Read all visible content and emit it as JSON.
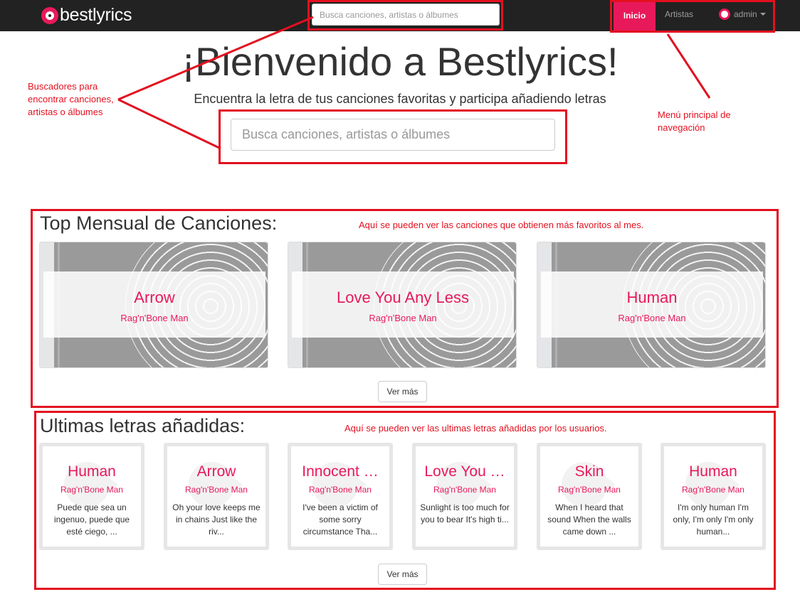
{
  "navbar": {
    "brand": "bestlyrics",
    "search_placeholder": "Busca canciones, artistas o álbumes",
    "nav_items": [
      "Inicio",
      "Artistas"
    ],
    "user_label": "admin"
  },
  "hero": {
    "title": "¡Bienvenido a Bestlyrics!",
    "subtitle": "Encuentra la letra de tus canciones favoritas y participa añadiendo letras",
    "search_placeholder": "Busca canciones, artistas o álbumes"
  },
  "annotations": {
    "search_note": "Buscadores para encontrar canciones, artistas o álbumes",
    "menu_note": "Menú principal de navegación",
    "top_note": "Aquí se pueden ver las canciones que obtienen más favoritos al mes.",
    "latest_note": "Aquí se pueden ver las ultimas letras añadidas por los usuarios.",
    "color": "#e3101f"
  },
  "top_monthly": {
    "title": "Top Mensual de Canciones:",
    "songs": [
      {
        "title": "Arrow",
        "artist": "Rag'n'Bone Man"
      },
      {
        "title": "Love You Any Less",
        "artist": "Rag'n'Bone Man"
      },
      {
        "title": "Human",
        "artist": "Rag'n'Bone Man"
      }
    ],
    "more_label": "Ver más"
  },
  "latest": {
    "title": "Ultimas letras añadidas:",
    "songs": [
      {
        "title": "Human",
        "artist": "Rag'n'Bone Man",
        "snippet": "Puede que sea un ingenuo, puede que esté ciego, ..."
      },
      {
        "title": "Arrow",
        "artist": "Rag'n'Bone Man",
        "snippet": "Oh your love keeps me in chains Just like the riv..."
      },
      {
        "title": "Innocent …",
        "artist": "Rag'n'Bone Man",
        "snippet": "I've been a victim of some sorry circumstance Tha..."
      },
      {
        "title": "Love You …",
        "artist": "Rag'n'Bone Man",
        "snippet": "Sunlight is too much for you to bear It's high ti..."
      },
      {
        "title": "Skin",
        "artist": "Rag'n'Bone Man",
        "snippet": "When I heard that sound When the walls came down ..."
      },
      {
        "title": "Human",
        "artist": "Rag'n'Bone Man",
        "snippet": "I'm only human I'm only, I'm only I'm only human..."
      }
    ],
    "more_label": "Ver más"
  },
  "colors": {
    "brand": "#e8195a",
    "navbar": "#222222"
  }
}
